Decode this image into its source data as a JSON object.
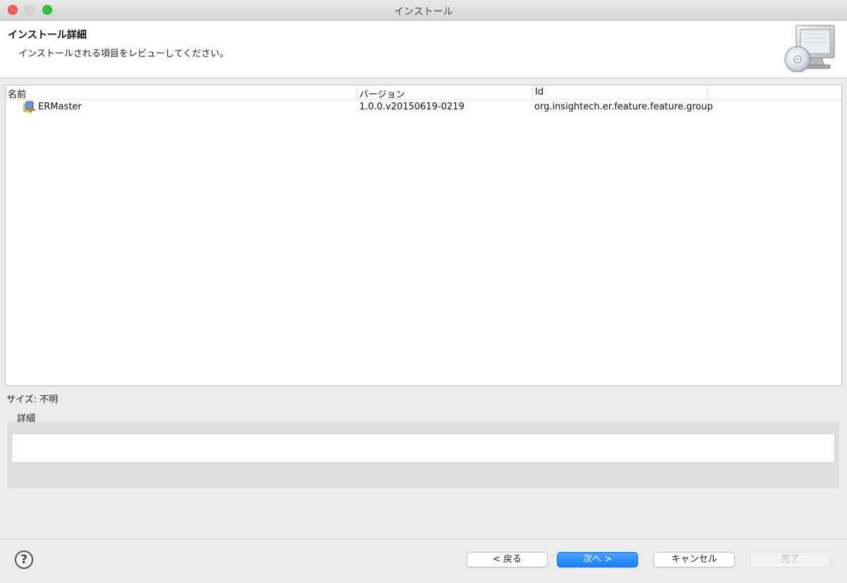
{
  "window": {
    "title": "インストール"
  },
  "banner": {
    "title": "インストール詳細",
    "description": "インストールされる項目をレビューしてください。",
    "icon": "install-cd-monitor-icon"
  },
  "table": {
    "columns": [
      "名前",
      "バージョン",
      "Id"
    ],
    "rows": [
      {
        "name": "ERMaster",
        "version": "1.0.0.v20150619-0219",
        "id": "org.insightech.er.feature.feature.group",
        "icon": "feature-icon"
      }
    ]
  },
  "size": {
    "label": "サイズ: 不明"
  },
  "details": {
    "label": "詳細",
    "content": ""
  },
  "buttons": {
    "help": "?",
    "back": "< 戻る",
    "next": "次へ >",
    "cancel": "キャンセル",
    "finish": "完了"
  },
  "colors": {
    "primary_button": "#1a7ff5",
    "close": "#fd5f57",
    "maximize": "#2ac840"
  }
}
